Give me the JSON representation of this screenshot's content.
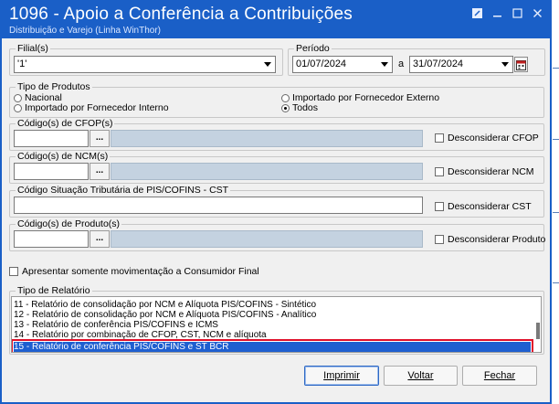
{
  "window": {
    "title": "1096 - Apoio a Conferência a Contribuições",
    "subtitle": "Distribuição e Varejo (Linha WinThor)",
    "controls": {
      "help": "☐",
      "minimize": "_",
      "maximize": "□",
      "close": "×"
    }
  },
  "filial": {
    "label": "Filial(s)",
    "value": "'1'"
  },
  "periodo": {
    "label": "Período",
    "start": "01/07/2024",
    "separator": "a",
    "end": "31/07/2024"
  },
  "tipo_produtos": {
    "label": "Tipo de Produtos",
    "options": {
      "nacional": "Nacional",
      "importado_interno": "Importado por Fornecedor Interno",
      "importado_externo": "Importado por Fornecedor Externo",
      "todos": "Todos"
    },
    "selected": "Todos"
  },
  "cfop": {
    "label": "Código(s) de CFOP(s)",
    "value": "",
    "check_label": "Desconsiderar CFOP",
    "button": "..."
  },
  "ncm": {
    "label": "Código(s) de NCM(s)",
    "value": "",
    "check_label": "Desconsiderar NCM",
    "button": "..."
  },
  "cst": {
    "label": "Código Situação Tributária de PIS/COFINS - CST",
    "value": "",
    "check_label": "Desconsiderar CST"
  },
  "produto": {
    "label": "Código(s) de Produto(s)",
    "value": "",
    "check_label": "Desconsiderar Produto",
    "button": "..."
  },
  "consumidor_final": {
    "label": "Apresentar somente movimentação a Consumidor Final"
  },
  "tipo_relatorio": {
    "label": "Tipo de Relatório",
    "items": [
      "11 - Relatório de consolidação por NCM e Alíquota PIS/COFINS - Sintético",
      "12 - Relatório de consolidação por NCM e Alíquota PIS/COFINS - Analítico",
      "13 - Relatório de conferência PIS/COFINS e ICMS",
      "14 - Relatório por combinação de CFOP, CST, NCM e alíquota",
      "15 - Relatório de conferência PIS/COFINS e ST BCR"
    ],
    "selected_index": 4
  },
  "buttons": {
    "imprimir": "Imprimir",
    "voltar": "Voltar",
    "fechar": "Fechar"
  },
  "colors": {
    "titlebar": "#1a5fc7",
    "selection": "#1f5fd0",
    "highlight_border": "#e0102a"
  }
}
